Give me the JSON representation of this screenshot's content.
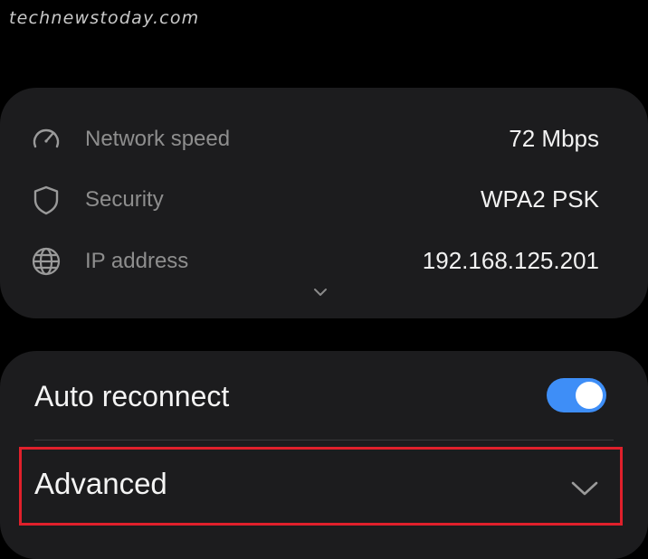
{
  "watermark": "technewstoday.com",
  "info": {
    "rows": [
      {
        "icon": "speedometer-icon",
        "label": "Network speed",
        "value": "72 Mbps"
      },
      {
        "icon": "shield-icon",
        "label": "Security",
        "value": "WPA2 PSK"
      },
      {
        "icon": "globe-icon",
        "label": "IP address",
        "value": "192.168.125.201"
      }
    ],
    "expand_icon": "chevron-down-icon"
  },
  "settings": {
    "auto_reconnect": {
      "label": "Auto reconnect",
      "enabled": true
    },
    "advanced": {
      "label": "Advanced",
      "icon": "chevron-down-icon"
    }
  },
  "colors": {
    "background": "#000000",
    "card": "#1c1c1e",
    "toggle_on": "#3e8ef7",
    "highlight": "#e0202b",
    "label_muted": "#8e8e8e",
    "text_primary": "#f2f2f2"
  }
}
